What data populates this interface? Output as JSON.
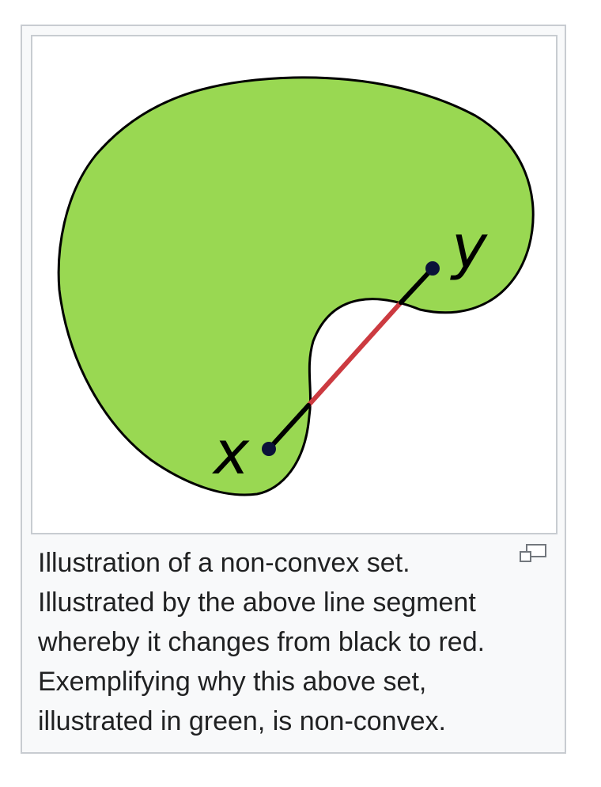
{
  "figure": {
    "shape_color": "#99d852",
    "outline_color": "#000000",
    "segment_inside_color": "#000000",
    "segment_outside_color": "#cc3a40",
    "point_color": "#0b1239",
    "point_x_label": "x",
    "point_y_label": "y"
  },
  "caption": {
    "lines": [
      "Illustration of a non-convex set.",
      "Illustrated by the above line segment",
      "whereby it changes from black to red.",
      "Exemplifying why this above set,",
      "illustrated in green, is non-convex."
    ]
  },
  "icons": {
    "enlarge": "magnify-clip-icon"
  }
}
